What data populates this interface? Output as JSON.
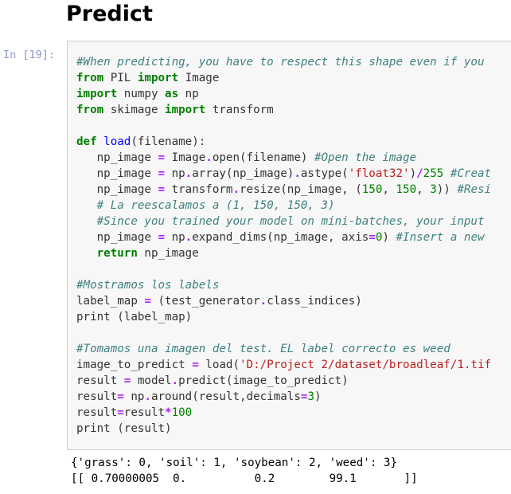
{
  "heading": "Predict",
  "prompt": "In [19]:",
  "code_lines": [
    [
      {
        "t": "#When predicting, you have to respect this shape even if you",
        "c": "c"
      }
    ],
    [
      {
        "t": "from",
        "c": "k"
      },
      {
        "t": " PIL ",
        "c": ""
      },
      {
        "t": "import",
        "c": "k"
      },
      {
        "t": " Image",
        "c": ""
      }
    ],
    [
      {
        "t": "import",
        "c": "k"
      },
      {
        "t": " numpy ",
        "c": ""
      },
      {
        "t": "as",
        "c": "k"
      },
      {
        "t": " np",
        "c": ""
      }
    ],
    [
      {
        "t": "from",
        "c": "k"
      },
      {
        "t": " skimage ",
        "c": ""
      },
      {
        "t": "import",
        "c": "k"
      },
      {
        "t": " transform",
        "c": ""
      }
    ],
    [],
    [
      {
        "t": "def",
        "c": "k"
      },
      {
        "t": " ",
        "c": ""
      },
      {
        "t": "load",
        "c": "f"
      },
      {
        "t": "(filename):",
        "c": ""
      }
    ],
    [
      {
        "t": "   np_image ",
        "c": ""
      },
      {
        "t": "=",
        "c": "o"
      },
      {
        "t": " Image",
        "c": ""
      },
      {
        "t": ".",
        "c": "o"
      },
      {
        "t": "open(filename) ",
        "c": ""
      },
      {
        "t": "#Open the image",
        "c": "c"
      }
    ],
    [
      {
        "t": "   np_image ",
        "c": ""
      },
      {
        "t": "=",
        "c": "o"
      },
      {
        "t": " np",
        "c": ""
      },
      {
        "t": ".",
        "c": "o"
      },
      {
        "t": "array(np_image)",
        "c": ""
      },
      {
        "t": ".",
        "c": "o"
      },
      {
        "t": "astype(",
        "c": ""
      },
      {
        "t": "'float32'",
        "c": "s"
      },
      {
        "t": ")",
        "c": ""
      },
      {
        "t": "/",
        "c": "o"
      },
      {
        "t": "255",
        "c": "m"
      },
      {
        "t": " ",
        "c": ""
      },
      {
        "t": "#Creat",
        "c": "c"
      }
    ],
    [
      {
        "t": "   np_image ",
        "c": ""
      },
      {
        "t": "=",
        "c": "o"
      },
      {
        "t": " transform",
        "c": ""
      },
      {
        "t": ".",
        "c": "o"
      },
      {
        "t": "resize(np_image, (",
        "c": ""
      },
      {
        "t": "150",
        "c": "m"
      },
      {
        "t": ", ",
        "c": ""
      },
      {
        "t": "150",
        "c": "m"
      },
      {
        "t": ", ",
        "c": ""
      },
      {
        "t": "3",
        "c": "m"
      },
      {
        "t": ")) ",
        "c": ""
      },
      {
        "t": "#Resi",
        "c": "c"
      }
    ],
    [
      {
        "t": "   ",
        "c": ""
      },
      {
        "t": "# La reescalamos a (1, 150, 150, 3)",
        "c": "c"
      }
    ],
    [
      {
        "t": "   ",
        "c": ""
      },
      {
        "t": "#Since you trained your model on mini-batches, your input",
        "c": "c"
      }
    ],
    [
      {
        "t": "   np_image ",
        "c": ""
      },
      {
        "t": "=",
        "c": "o"
      },
      {
        "t": " np",
        "c": ""
      },
      {
        "t": ".",
        "c": "o"
      },
      {
        "t": "expand_dims(np_image, axis",
        "c": ""
      },
      {
        "t": "=",
        "c": "o"
      },
      {
        "t": "0",
        "c": "m"
      },
      {
        "t": ") ",
        "c": ""
      },
      {
        "t": "#Insert a new",
        "c": "c"
      }
    ],
    [
      {
        "t": "   ",
        "c": ""
      },
      {
        "t": "return",
        "c": "k"
      },
      {
        "t": " np_image",
        "c": ""
      }
    ],
    [],
    [
      {
        "t": "#Mostramos los labels",
        "c": "c"
      }
    ],
    [
      {
        "t": "label_map ",
        "c": ""
      },
      {
        "t": "=",
        "c": "o"
      },
      {
        "t": " (test_generator",
        "c": ""
      },
      {
        "t": ".",
        "c": "o"
      },
      {
        "t": "class_indices)",
        "c": ""
      }
    ],
    [
      {
        "t": "print (label_map)",
        "c": ""
      }
    ],
    [],
    [
      {
        "t": "#Tomamos una imagen del test. EL label correcto es weed",
        "c": "c"
      }
    ],
    [
      {
        "t": "image_to_predict ",
        "c": ""
      },
      {
        "t": "=",
        "c": "o"
      },
      {
        "t": " load(",
        "c": ""
      },
      {
        "t": "'D:/Project 2/dataset/broadleaf/1.tif",
        "c": "s"
      }
    ],
    [
      {
        "t": "result ",
        "c": ""
      },
      {
        "t": "=",
        "c": "o"
      },
      {
        "t": " model",
        "c": ""
      },
      {
        "t": ".",
        "c": "o"
      },
      {
        "t": "predict(image_to_predict)",
        "c": ""
      }
    ],
    [
      {
        "t": "result",
        "c": ""
      },
      {
        "t": "=",
        "c": "o"
      },
      {
        "t": " np",
        "c": ""
      },
      {
        "t": ".",
        "c": "o"
      },
      {
        "t": "around(result,decimals",
        "c": ""
      },
      {
        "t": "=",
        "c": "o"
      },
      {
        "t": "3",
        "c": "m"
      },
      {
        "t": ")",
        "c": ""
      }
    ],
    [
      {
        "t": "result",
        "c": ""
      },
      {
        "t": "=",
        "c": "o"
      },
      {
        "t": "result",
        "c": ""
      },
      {
        "t": "*",
        "c": "o"
      },
      {
        "t": "100",
        "c": "m"
      }
    ],
    [
      {
        "t": "print (result)",
        "c": ""
      }
    ]
  ],
  "output_lines": [
    "{'grass': 0, 'soil': 1, 'soybean': 2, 'weed': 3}",
    "[[ 0.70000005  0.          0.2        99.1       ]]"
  ]
}
